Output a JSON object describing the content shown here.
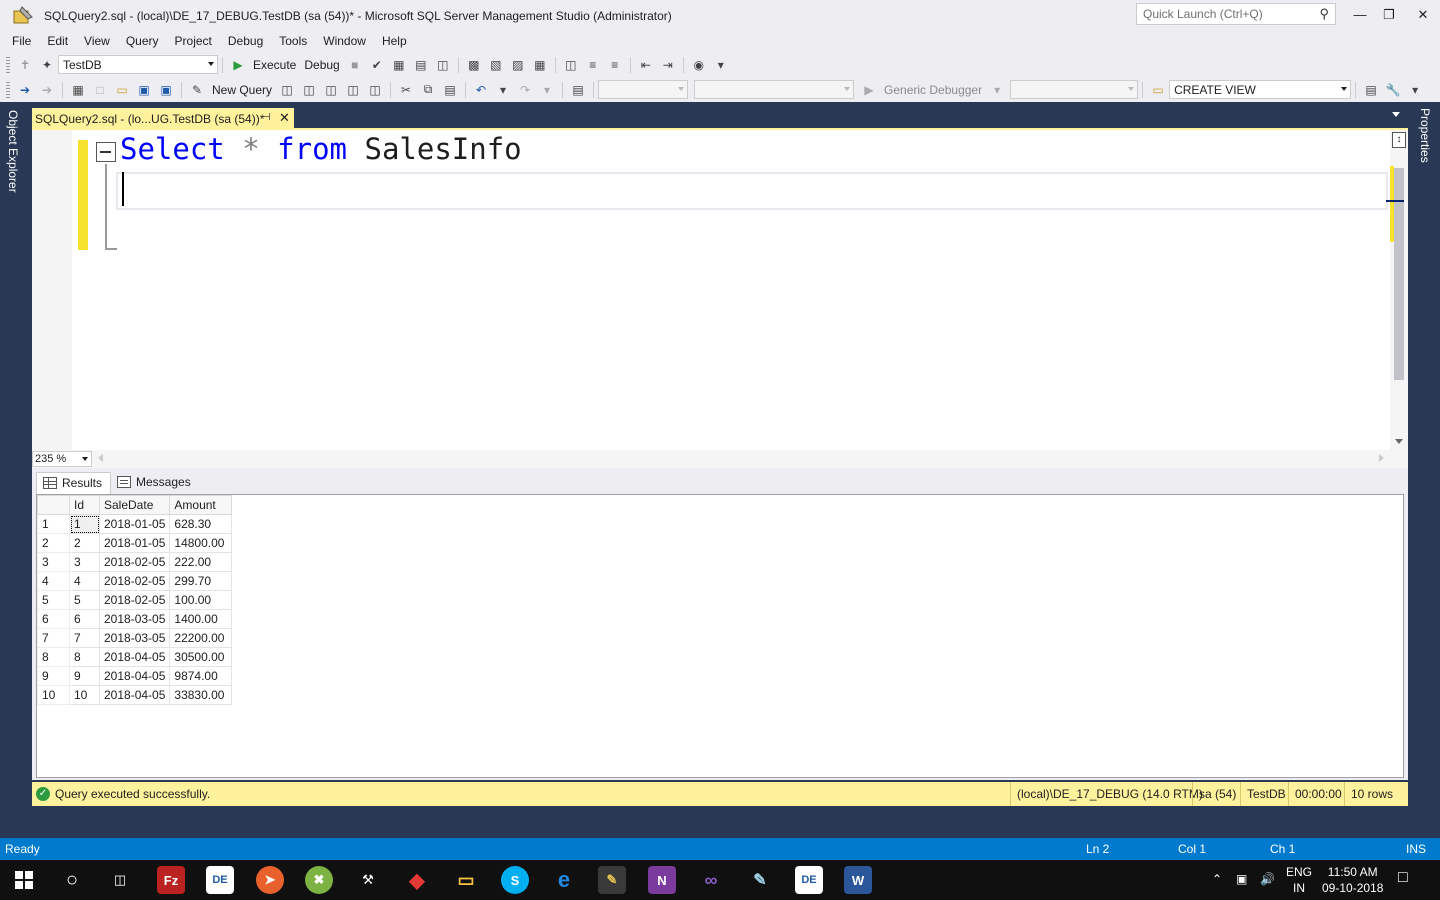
{
  "window": {
    "title": "SQLQuery2.sql - (local)\\DE_17_DEBUG.TestDB (sa (54))* - Microsoft SQL Server Management Studio (Administrator)",
    "quick_launch_placeholder": "Quick Launch (Ctrl+Q)",
    "minimize": "—",
    "restore": "❐",
    "close": "✕"
  },
  "menu": [
    "File",
    "Edit",
    "View",
    "Query",
    "Project",
    "Debug",
    "Tools",
    "Window",
    "Help"
  ],
  "toolbar1": {
    "database": "TestDB",
    "execute": "Execute",
    "debug": "Debug"
  },
  "toolbar2": {
    "new_query": "New Query",
    "debugger": "Generic Debugger",
    "create_view": "CREATE VIEW"
  },
  "side_tabs": {
    "left": "Object Explorer",
    "right": "Properties"
  },
  "doc_tab": {
    "label": "SQLQuery2.sql - (lo...UG.TestDB (sa (54))*",
    "pin": "⊣",
    "close": "✕"
  },
  "editor": {
    "keyword_select": "Select",
    "star": "*",
    "keyword_from": "from",
    "table": "SalesInfo"
  },
  "zoom": "235 %",
  "results": {
    "tab_results": "Results",
    "tab_messages": "Messages",
    "columns": [
      "Id",
      "SaleDate",
      "Amount"
    ],
    "rows": [
      [
        "1",
        "1",
        "2018-01-05",
        "628.30"
      ],
      [
        "2",
        "2",
        "2018-01-05",
        "14800.00"
      ],
      [
        "3",
        "3",
        "2018-02-05",
        "222.00"
      ],
      [
        "4",
        "4",
        "2018-02-05",
        "299.70"
      ],
      [
        "5",
        "5",
        "2018-02-05",
        "100.00"
      ],
      [
        "6",
        "6",
        "2018-03-05",
        "1400.00"
      ],
      [
        "7",
        "7",
        "2018-03-05",
        "22200.00"
      ],
      [
        "8",
        "8",
        "2018-04-05",
        "30500.00"
      ],
      [
        "9",
        "9",
        "2018-04-05",
        "9874.00"
      ],
      [
        "10",
        "10",
        "2018-04-05",
        "33830.00"
      ]
    ]
  },
  "query_status": {
    "message": "Query executed successfully.",
    "server": "(local)\\DE_17_DEBUG (14.0 RTM)",
    "user": "sa (54)",
    "database": "TestDB",
    "time": "00:00:00",
    "rows": "10 rows"
  },
  "status_bar": {
    "state": "Ready",
    "ln": "Ln 2",
    "col": "Col 1",
    "ch": "Ch 1",
    "mode": "INS"
  },
  "taskbar": {
    "lang_top": "ENG",
    "lang_bottom": "IN",
    "time": "11:50 AM",
    "date": "09-10-2018"
  },
  "colors": {
    "accent": "#007acc",
    "tab_yellow": "#fff29d",
    "dark_frame": "#293955"
  }
}
